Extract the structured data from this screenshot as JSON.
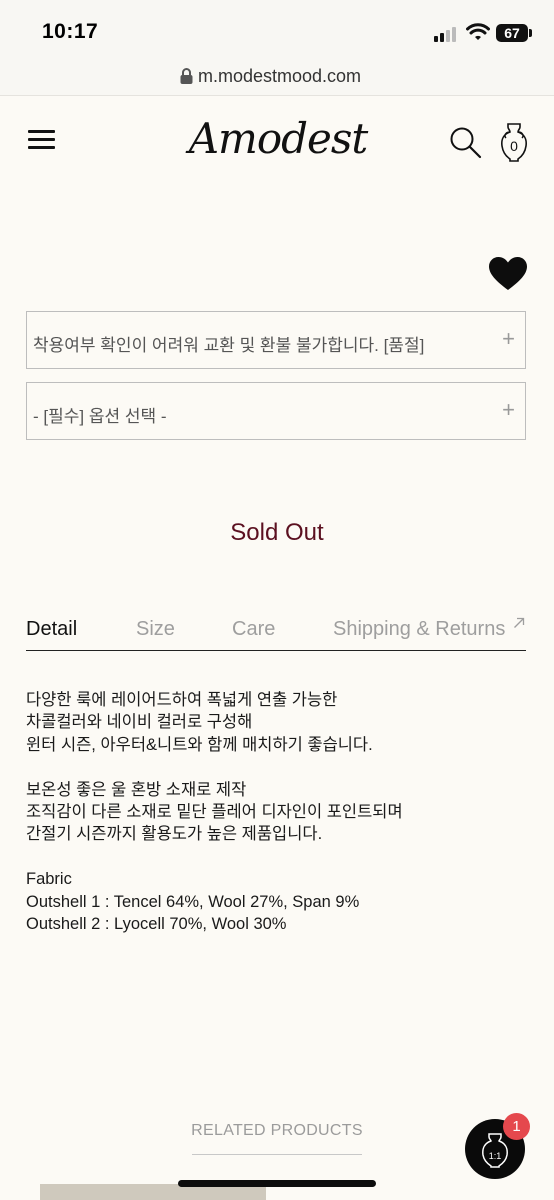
{
  "status_bar": {
    "time": "10:17",
    "battery": "67"
  },
  "browser": {
    "url": "m.modestmood.com"
  },
  "header": {
    "logo": "Amodest",
    "cart_count": "0"
  },
  "options": [
    {
      "label": "착용여부 확인이 어려워 교환 및 환불 불가합니다. [품절]",
      "icon": "+"
    },
    {
      "label": "- [필수] 옵션 선택 -",
      "icon": "+"
    }
  ],
  "status": {
    "sold_out": "Sold Out"
  },
  "tabs": [
    {
      "label": "Detail",
      "active": true
    },
    {
      "label": "Size"
    },
    {
      "label": "Care"
    },
    {
      "label": "Shipping & Returns"
    }
  ],
  "detail": {
    "lines": [
      "다양한 룩에 레이어드하여 폭넓게 연출 가능한",
      "차콜컬러와 네이비 컬러로 구성해",
      "윈터 시즌, 아우터&니트와 함께 매치하기 좋습니다.",
      "",
      "보온성 좋은 울 혼방 소재로 제작",
      "조직감이 다른 소재로 밑단 플레어 디자인이 포인트되며",
      "간절기 시즌까지 활용도가 높은 제품입니다.",
      "",
      "Fabric",
      "Outshell 1 : Tencel 64%, Wool 27%, Span 9%",
      "Outshell 2 : Lyocell 70%, Wool 30%"
    ]
  },
  "related": {
    "title": "RELATED PRODUCTS"
  },
  "chat": {
    "badge": "1",
    "icon_text": "1:1"
  },
  "colors": {
    "sold_out": "#5b1020",
    "background": "#fcfaf5",
    "badge": "#e5484d"
  }
}
